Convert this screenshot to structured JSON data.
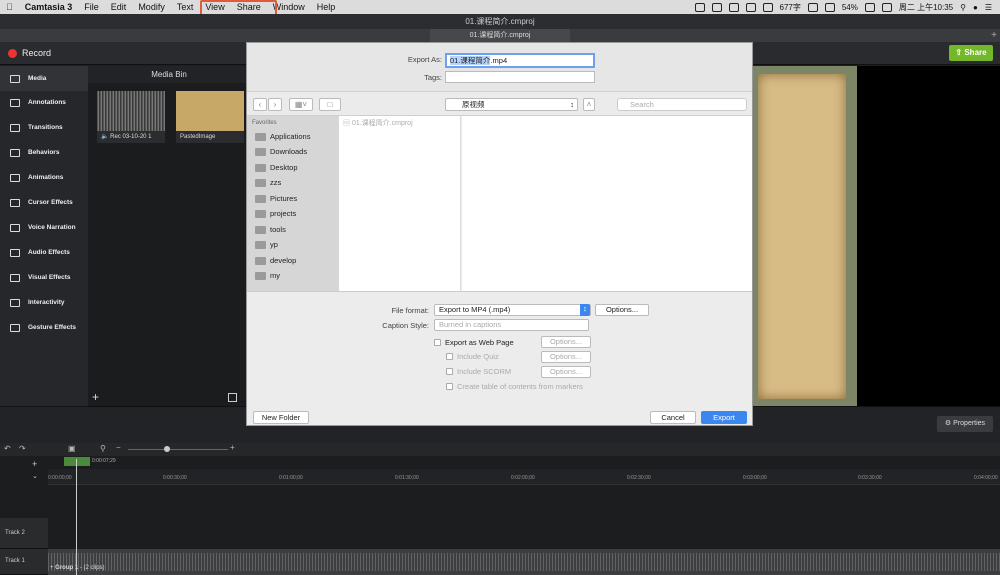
{
  "menubar": {
    "app": "Camtasia 3",
    "items": [
      "File",
      "Edit",
      "Modify",
      "Text",
      "View",
      "Share",
      "Window",
      "Help"
    ],
    "status": {
      "wordcount": "677字",
      "battery": "54%",
      "datetime": "周二 上午10:35"
    }
  },
  "window": {
    "title": "01.课程简介.cmproj",
    "tab": "01.课程简介.cmproj"
  },
  "toolbar": {
    "record": "Record",
    "share": "Share"
  },
  "sidebar": {
    "items": [
      "Media",
      "Annotations",
      "Transitions",
      "Behaviors",
      "Animations",
      "Cursor Effects",
      "Voice Narration",
      "Audio Effects",
      "Visual Effects",
      "Interactivity",
      "Gesture Effects"
    ]
  },
  "mediabin": {
    "title": "Media Bin",
    "clips": [
      "Rec 03-10-20 1",
      "PastedImage"
    ]
  },
  "dialog": {
    "export_as_label": "Export As:",
    "export_as_selected": "01.课程简介",
    "export_as_ext": ".mp4",
    "tags_label": "Tags:",
    "location": "原视频",
    "search_placeholder": "Search",
    "favorites_title": "Favorites",
    "favorites": [
      "Applications",
      "Downloads",
      "Desktop",
      "zzs",
      "Pictures",
      "projects",
      "tools",
      "yp",
      "develop",
      "my"
    ],
    "file": "01.课程简介.cmproj",
    "file_format_label": "File format:",
    "file_format": "Export to MP4 (.mp4)",
    "options": "Options...",
    "caption_label": "Caption Style:",
    "caption": "Burned in captions",
    "web_page": "Export as Web Page",
    "include_quiz": "Include Quiz",
    "include_scorm": "Include SCORM",
    "toc": "Create table of contents from markers",
    "new_folder": "New Folder",
    "cancel": "Cancel",
    "export": "Export"
  },
  "properties": "Properties",
  "timeline": {
    "playhead_time": "0:00:07;29",
    "ticks": [
      "0:00:00;00",
      "0:00:30;00",
      "0:01:00;00",
      "0:01:30;00",
      "0:02:00;00",
      "0:02:30;00",
      "0:03:00;00",
      "0:03:30;00",
      "0:04:00;00"
    ],
    "tracks": [
      "Track 2",
      "Track 1"
    ],
    "group": "Group 1",
    "group_clips": "- (2 clips)"
  },
  "colors": {
    "accent": "#3c86f0",
    "share": "#73b72a",
    "highlight": "#e25a3c"
  }
}
